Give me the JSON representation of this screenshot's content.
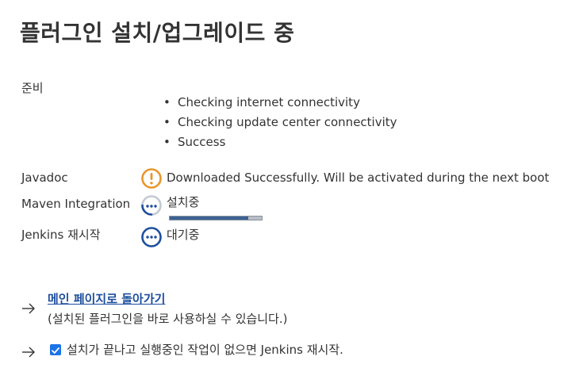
{
  "page": {
    "title": "플러그인 설치/업그레이드 중"
  },
  "preparation": {
    "label": "준비",
    "checks": [
      "Checking internet connectivity",
      "Checking update center connectivity",
      "Success"
    ]
  },
  "plugins": [
    {
      "name": "Javadoc",
      "status_icon": "warning-icon",
      "status_text": "Downloaded Successfully. Will be activated during the next boot"
    },
    {
      "name": "Maven Integration",
      "status_icon": "installing-spinner-icon",
      "status_text": "설치중",
      "progress_percent": 85
    },
    {
      "name": "Jenkins 재시작",
      "status_icon": "pending-icon",
      "status_text": "대기중"
    }
  ],
  "actions": {
    "back_link": "메인 페이지로 돌아가기",
    "back_note": "(설치된 플러그인을 바로 사용하실 수 있습니다.)",
    "restart_label": "설치가 끝나고 실행중인 작업이 없으면 Jenkins 재시작.",
    "restart_checked": true
  },
  "colors": {
    "warning": "#e8962a",
    "pending": "#1d4e9e",
    "link": "#1d4e9e",
    "progress_fill": "#3c6294",
    "checkbox": "#1a73e8"
  }
}
